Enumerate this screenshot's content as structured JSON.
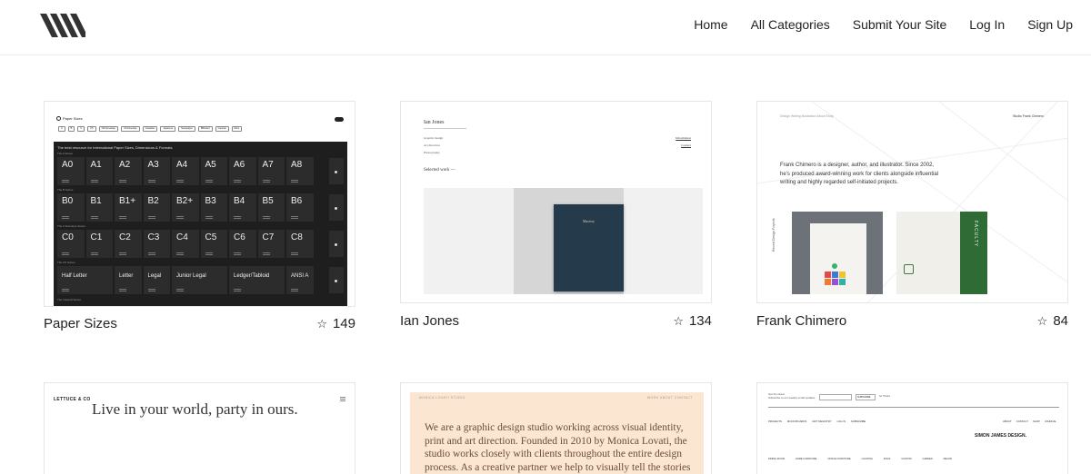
{
  "nav": {
    "items": [
      "Home",
      "All Categories",
      "Submit Your Site",
      "Log In",
      "Sign Up"
    ]
  },
  "cards": [
    {
      "title": "Paper Sizes",
      "stars": "149",
      "preview": {
        "brand": "Paper Sizes",
        "filters": [
          "A",
          "B",
          "C",
          "US",
          "ISO Envelope",
          "US Envelope",
          "Canadian",
          "Japanese",
          "Newspaper",
          "Billboard",
          "Imperial",
          "More"
        ],
        "headline": "The best resource for International Paper Sizes, Dimensions & Formats",
        "row_labels": [
          "The A Series",
          "The B Series",
          "The C Envelope Series",
          "The US Series",
          "The Imperial Series"
        ],
        "a_series": [
          "A0",
          "A1",
          "A2",
          "A3",
          "A4",
          "A5",
          "A6",
          "A7",
          "A8"
        ],
        "b_series": [
          "B0",
          "B1",
          "B1+",
          "B2",
          "B2+",
          "B3",
          "B4",
          "B5",
          "B6"
        ],
        "c_series": [
          "C0",
          "C1",
          "C2",
          "C3",
          "C4",
          "C5",
          "C6",
          "C7",
          "C8"
        ],
        "us_series": [
          "Half Letter",
          "Letter",
          "Legal",
          "Junior Legal",
          "Ledger/Tabloid",
          "ANSI A"
        ]
      }
    },
    {
      "title": "Ian Jones",
      "stars": "134",
      "preview": {
        "name": "Ian Jones",
        "meta": [
          "Graphic design",
          "Art direction",
          "Photography"
        ],
        "links": [
          "Information",
          "Contact"
        ],
        "selected": "Selected work —",
        "book_title": "Mastery"
      }
    },
    {
      "title": "Frank Chimero",
      "stars": "84",
      "preview": {
        "nav": "Design  Writing  Illustration  About  Shop",
        "studio": "Studio Frank Chimero",
        "intro": "Frank Chimero is a designer, author, and illustrator. Since 2002, he’s produced award-winning work for clients alongside influential writing and highly regarded self-initiated projects.",
        "side": "Recent Design Projects",
        "faculty": "FACULTY"
      }
    },
    {
      "preview": {
        "logo": "LETTUCE & CO",
        "tagline": "Live in your world, party in ours."
      }
    },
    {
      "preview": {
        "brand": "MONICA LOVATI STUDIO",
        "nav": "WORK   ABOUT   CONTACT",
        "body": "We are a graphic design studio working across visual identity, print and art direction. Founded in 2010 by Monica Lovati, the studio works closely with clients throughout the entire design process. As a creative partner we help to visually tell the stories behind clients’"
      }
    },
    {
      "preview": {
        "top": "Get the latest\nSubscribe to our weekly email updates",
        "button": "SUBSCRIBE",
        "no_thanks": "No Thanks",
        "cats": [
          "PROJECTS",
          "MOOD BOARDS",
          "GIFT REGISTRY",
          "LOG IN",
          "SUBSCRIBE"
        ],
        "right": [
          "ABOUT",
          "CONTACT",
          "SHOP",
          "JOURNAL"
        ],
        "logo": "SIMON JAMES DESIGN.",
        "cats2": [
          "DINING ROOM",
          "HOME FURNITURE",
          "OFFICE FURNITURE",
          "LIGHTING",
          "RUGS",
          "CUSTOM",
          "GARDEN",
          "DECOR"
        ]
      }
    }
  ]
}
